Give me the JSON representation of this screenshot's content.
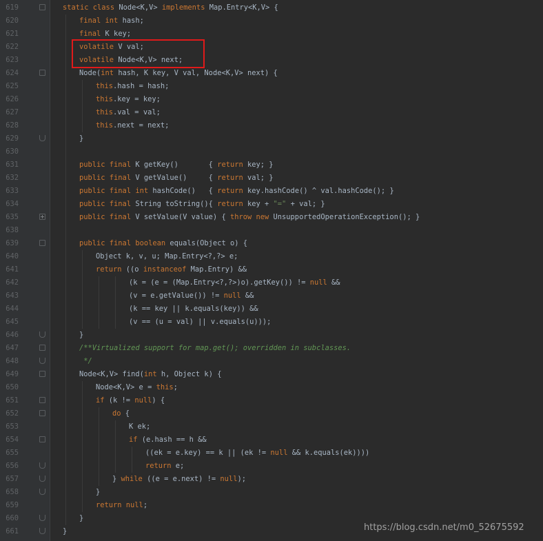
{
  "editor": {
    "lines": [
      {
        "num": "619",
        "indent": 0,
        "fold": "open",
        "segs": [
          [
            "kw",
            "static class "
          ],
          [
            "",
            "Node<K,V> "
          ],
          [
            "kw",
            "implements "
          ],
          [
            "",
            "Map.Entry<K,V> {"
          ]
        ]
      },
      {
        "num": "620",
        "indent": 1,
        "segs": [
          [
            "kw",
            "final int "
          ],
          [
            "",
            "hash;"
          ]
        ]
      },
      {
        "num": "621",
        "indent": 1,
        "segs": [
          [
            "kw",
            "final "
          ],
          [
            "",
            "K key;"
          ]
        ]
      },
      {
        "num": "622",
        "indent": 1,
        "segs": [
          [
            "kw",
            "volatile "
          ],
          [
            "",
            "V val;"
          ]
        ]
      },
      {
        "num": "623",
        "indent": 1,
        "segs": [
          [
            "kw",
            "volatile "
          ],
          [
            "",
            "Node<K,V> next;"
          ]
        ]
      },
      {
        "num": "624",
        "indent": 1,
        "fold": "open",
        "segs": [
          [
            "",
            "Node("
          ],
          [
            "kw",
            "int "
          ],
          [
            "",
            "hash, K key, V val, Node<K,V> next) {"
          ]
        ]
      },
      {
        "num": "625",
        "indent": 2,
        "segs": [
          [
            "kw",
            "this"
          ],
          [
            "",
            ".hash = hash;"
          ]
        ]
      },
      {
        "num": "626",
        "indent": 2,
        "segs": [
          [
            "kw",
            "this"
          ],
          [
            "",
            ".key = key;"
          ]
        ]
      },
      {
        "num": "627",
        "indent": 2,
        "segs": [
          [
            "kw",
            "this"
          ],
          [
            "",
            ".val = val;"
          ]
        ]
      },
      {
        "num": "628",
        "indent": 2,
        "segs": [
          [
            "kw",
            "this"
          ],
          [
            "",
            ".next = next;"
          ]
        ]
      },
      {
        "num": "629",
        "indent": 1,
        "fold": "end",
        "segs": [
          [
            "",
            "}"
          ]
        ]
      },
      {
        "num": "630",
        "indent": 1,
        "segs": []
      },
      {
        "num": "631",
        "indent": 1,
        "segs": [
          [
            "kw",
            "public final "
          ],
          [
            "",
            "K getKey()       { "
          ],
          [
            "kw",
            "return "
          ],
          [
            "",
            "key; }"
          ]
        ]
      },
      {
        "num": "632",
        "indent": 1,
        "segs": [
          [
            "kw",
            "public final "
          ],
          [
            "",
            "V getValue()     { "
          ],
          [
            "kw",
            "return "
          ],
          [
            "",
            "val; }"
          ]
        ]
      },
      {
        "num": "633",
        "indent": 1,
        "segs": [
          [
            "kw",
            "public final int "
          ],
          [
            "",
            "hashCode()   { "
          ],
          [
            "kw",
            "return "
          ],
          [
            "",
            "key.hashCode() ^ val.hashCode(); }"
          ]
        ]
      },
      {
        "num": "634",
        "indent": 1,
        "segs": [
          [
            "kw",
            "public final "
          ],
          [
            "",
            "String toString(){ "
          ],
          [
            "kw",
            "return "
          ],
          [
            "",
            "key + "
          ],
          [
            "str",
            "\"=\""
          ],
          [
            "",
            " + val; }"
          ]
        ]
      },
      {
        "num": "635",
        "indent": 1,
        "fold": "plus",
        "segs": [
          [
            "kw",
            "public final "
          ],
          [
            "",
            "V setValue(V value) { "
          ],
          [
            "kw",
            "throw new "
          ],
          [
            "",
            "UnsupportedOperationException(); }"
          ]
        ]
      },
      {
        "num": "638",
        "indent": 1,
        "segs": []
      },
      {
        "num": "639",
        "indent": 1,
        "fold": "open",
        "segs": [
          [
            "kw",
            "public final boolean "
          ],
          [
            "",
            "equals(Object o) {"
          ]
        ]
      },
      {
        "num": "640",
        "indent": 2,
        "segs": [
          [
            "",
            "Object k, v, u; Map.Entry<?,?> e;"
          ]
        ]
      },
      {
        "num": "641",
        "indent": 2,
        "segs": [
          [
            "kw",
            "return "
          ],
          [
            "",
            "((o "
          ],
          [
            "kw",
            "instanceof "
          ],
          [
            "",
            "Map.Entry) &&"
          ]
        ]
      },
      {
        "num": "642",
        "indent": 4,
        "segs": [
          [
            "",
            "(k = (e = (Map.Entry<?,?>)o).getKey()) != "
          ],
          [
            "kw",
            "null "
          ],
          [
            "",
            "&&"
          ]
        ]
      },
      {
        "num": "643",
        "indent": 4,
        "segs": [
          [
            "",
            "(v = e.getValue()) != "
          ],
          [
            "kw",
            "null "
          ],
          [
            "",
            "&&"
          ]
        ]
      },
      {
        "num": "644",
        "indent": 4,
        "segs": [
          [
            "",
            "(k == key || k.equals(key)) &&"
          ]
        ]
      },
      {
        "num": "645",
        "indent": 4,
        "segs": [
          [
            "",
            "(v == (u = val) || v.equals(u)));"
          ]
        ]
      },
      {
        "num": "646",
        "indent": 1,
        "fold": "end",
        "segs": [
          [
            "",
            "}"
          ]
        ]
      },
      {
        "num": "647",
        "indent": 1,
        "fold": "open",
        "segs": [
          [
            "cm",
            "/**Virtualized support for map.get(); overridden in subclasses."
          ]
        ]
      },
      {
        "num": "648",
        "indent": 1,
        "fold": "end",
        "segs": [
          [
            "cm",
            " */"
          ]
        ]
      },
      {
        "num": "649",
        "indent": 1,
        "fold": "open",
        "segs": [
          [
            "",
            "Node<K,V> find("
          ],
          [
            "kw",
            "int "
          ],
          [
            "",
            "h, Object k) {"
          ]
        ]
      },
      {
        "num": "650",
        "indent": 2,
        "segs": [
          [
            "",
            "Node<K,V> e = "
          ],
          [
            "kw",
            "this"
          ],
          [
            "",
            ";"
          ]
        ]
      },
      {
        "num": "651",
        "indent": 2,
        "fold": "open",
        "segs": [
          [
            "kw",
            "if "
          ],
          [
            "",
            "(k != "
          ],
          [
            "kw",
            "null"
          ],
          [
            "",
            ") {"
          ]
        ]
      },
      {
        "num": "652",
        "indent": 3,
        "fold": "open",
        "segs": [
          [
            "kw",
            "do "
          ],
          [
            "",
            "{"
          ]
        ]
      },
      {
        "num": "653",
        "indent": 4,
        "segs": [
          [
            "",
            "K ek;"
          ]
        ]
      },
      {
        "num": "654",
        "indent": 4,
        "fold": "open",
        "segs": [
          [
            "kw",
            "if "
          ],
          [
            "",
            "(e.hash == h &&"
          ]
        ]
      },
      {
        "num": "655",
        "indent": 5,
        "segs": [
          [
            "",
            "((ek = e.key) == k || (ek != "
          ],
          [
            "kw",
            "null "
          ],
          [
            "",
            "&& k.equals(ek))))"
          ]
        ]
      },
      {
        "num": "656",
        "indent": 5,
        "fold": "end",
        "segs": [
          [
            "kw",
            "return "
          ],
          [
            "",
            "e;"
          ]
        ]
      },
      {
        "num": "657",
        "indent": 3,
        "fold": "end",
        "segs": [
          [
            "",
            "} "
          ],
          [
            "kw",
            "while "
          ],
          [
            "",
            "((e = e.next) != "
          ],
          [
            "kw",
            "null"
          ],
          [
            "",
            ");"
          ]
        ]
      },
      {
        "num": "658",
        "indent": 2,
        "fold": "end",
        "segs": [
          [
            "",
            "}"
          ]
        ]
      },
      {
        "num": "659",
        "indent": 2,
        "segs": [
          [
            "kw",
            "return null"
          ],
          [
            "",
            ";"
          ]
        ]
      },
      {
        "num": "660",
        "indent": 1,
        "fold": "end",
        "segs": [
          [
            "",
            "}"
          ]
        ]
      },
      {
        "num": "661",
        "indent": 0,
        "fold": "end",
        "segs": [
          [
            "",
            "}"
          ]
        ]
      }
    ]
  },
  "watermark": "https://blog.csdn.net/m0_52675592",
  "colors": {
    "background": "#2b2b2b",
    "gutter": "#313335",
    "line_number": "#606366",
    "keyword": "#cc7832",
    "identifier": "#a9b7c6",
    "comment": "#629755",
    "string": "#6a8759",
    "highlight_box": "#e01a1a"
  }
}
